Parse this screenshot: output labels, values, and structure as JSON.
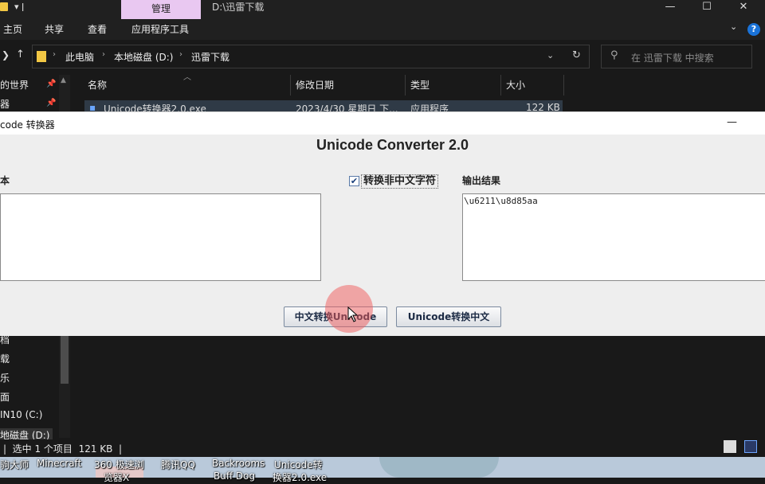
{
  "explorer": {
    "manage_tab": "管理",
    "window_title": "D:\\迅雷下载",
    "ribbon_tabs": [
      "主页",
      "共享",
      "查看",
      "应用程序工具"
    ],
    "breadcrumb": [
      "此电脑",
      "本地磁盘 (D:)",
      "迅雷下载"
    ],
    "search_placeholder": "在 迅雷下载 中搜索",
    "columns": [
      "名称",
      "修改日期",
      "类型",
      "大小"
    ],
    "file": {
      "name": "Unicode转换器2.0.exe",
      "date": "2023/4/30 星期日 下...",
      "type": "应用程序",
      "size": "122 KB"
    },
    "nav_items": [
      "的世界",
      "器",
      "档",
      "载",
      "乐",
      "面",
      "IN10 (C:)",
      "地磁盘 (D:)"
    ],
    "status": "|  选中 1 个项目  121 KB  |"
  },
  "desktop": {
    "icons_row1": [
      "驹大师",
      "Minecraft",
      "360 极速浏",
      "腾讯QQ",
      "Backrooms",
      "Unicode转"
    ],
    "icons_row2": [
      "览器X",
      "Buff Dog",
      "换器2.0.exe"
    ]
  },
  "dialog": {
    "title": "code 转换器",
    "heading": "Unicode Converter 2.0",
    "input_label": "本",
    "checkbox_label": "转换非中文字符",
    "checkbox_checked": true,
    "output_label": "输出结果",
    "output_value": "\\u6211\\u8d85aa",
    "btn_to_unicode": "中文转换Unicode",
    "btn_to_chinese": "Unicode转换中文"
  },
  "colors": {
    "manage_tab": "#e9c8f1",
    "accent": "#1a73d9",
    "click_indicator": "#f05a5a"
  }
}
